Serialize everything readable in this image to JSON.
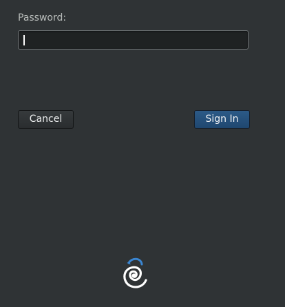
{
  "login": {
    "password_label": "Password:",
    "password_value": "",
    "cancel_label": "Cancel",
    "signin_label": "Sign In"
  },
  "icons": {
    "logo": "debian-swirl-power-icon",
    "caret": "text-caret"
  },
  "colors": {
    "background": "#2f3335",
    "field_bg": "#1f2223",
    "primary_button": "#2c5a87",
    "logo_accent": "#3a86d2"
  }
}
